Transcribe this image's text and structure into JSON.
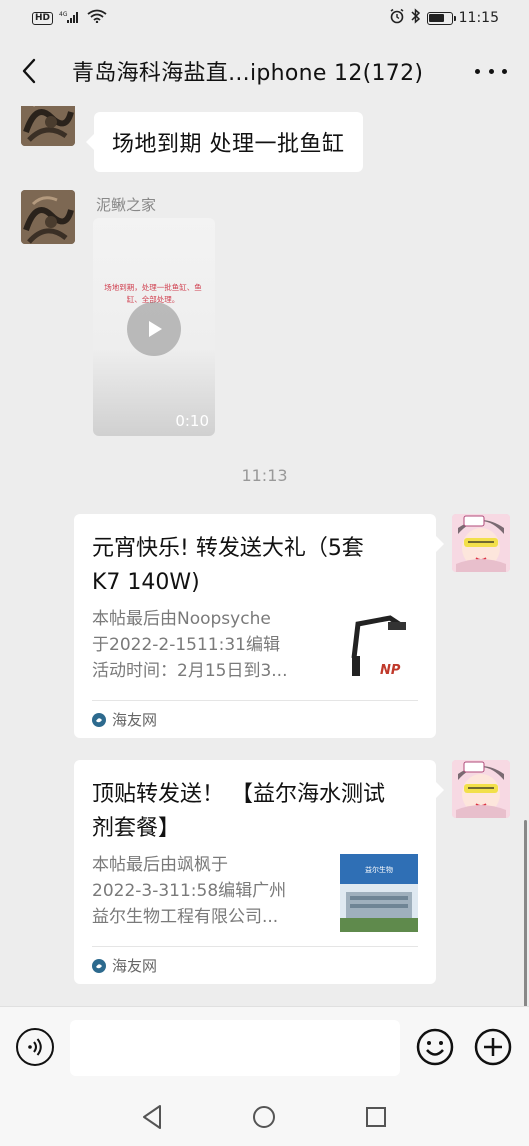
{
  "status_bar": {
    "hd": "HD",
    "network": "4G",
    "time": "11:15"
  },
  "header": {
    "title": "青岛海科海盐直...iphone 12(172)"
  },
  "messages": {
    "text_message": "场地到期 处理一批鱼缸",
    "sender_name": "泥鳅之家",
    "video_caption": "场地到期，处理一批鱼缸、鱼缸、全部处理。",
    "video_duration": "0:10",
    "time_separator": "11:13"
  },
  "cards": [
    {
      "title": "元宵快乐! 转发送大礼（5套K7  140W)",
      "title_line1": "元宵快乐! 转发送大礼（5套",
      "title_line2": "K7  140W)",
      "desc_line1": "本帖最后由Noopsyche",
      "desc_line2": "于2022-2-1511:31编辑",
      "desc_line3": "活动时间：2月15日到3...",
      "thumb_label": "NP",
      "source": "海友网"
    },
    {
      "title_line1": "顶贴转发送！ 【益尔海水测试",
      "title_line2": "剂套餐】",
      "desc_line1": "本帖最后由飒枫于",
      "desc_line2": "2022-3-311:58编辑广州",
      "desc_line3": "益尔生物工程有限公司...",
      "thumb_text": "益尔生物",
      "source": "海友网"
    }
  ],
  "input": {
    "placeholder": ""
  },
  "icons": {
    "back": "chevron-left-icon",
    "more": "more-dots-icon",
    "voice": "voice-icon",
    "emoji": "emoji-icon",
    "plus": "plus-icon",
    "play": "play-icon"
  },
  "colors": {
    "background": "#ededed",
    "bubble": "#ffffff",
    "card_source_icon": "#2d6a8e"
  }
}
